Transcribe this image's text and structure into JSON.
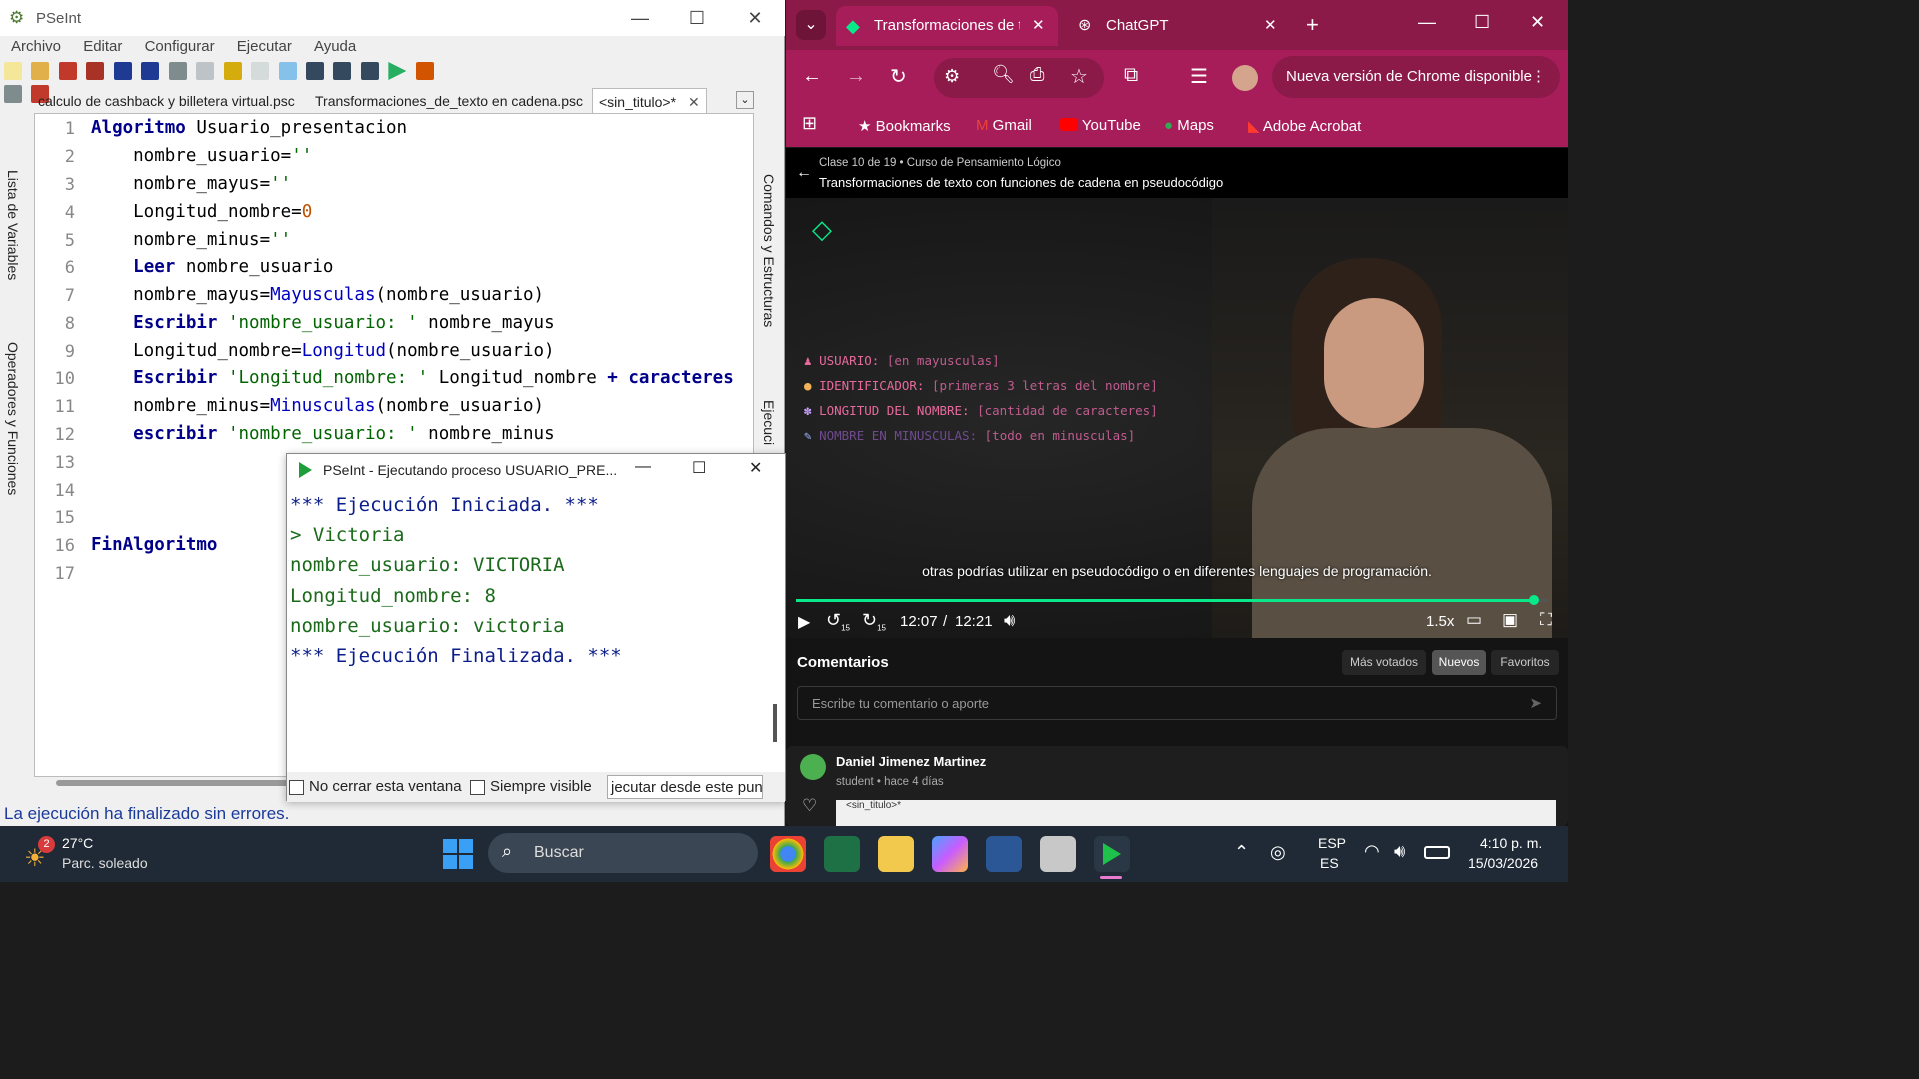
{
  "pseint": {
    "title": "PSeInt",
    "menu": [
      "Archivo",
      "Editar",
      "Configurar",
      "Ejecutar",
      "Ayuda"
    ],
    "tabs": [
      "calculo de cashback y billetera virtual.psc",
      "Transformaciones_de_texto en cadena.psc",
      "<sin_titulo>*"
    ],
    "left_panel": [
      "Lista de Variables",
      "Operadores y Funciones"
    ],
    "right_panel": [
      "Comandos y Estructuras",
      "Ejecuci"
    ],
    "status": "La ejecución ha finalizado sin errores.",
    "line_numbers": [
      "1",
      "2",
      "3",
      "4",
      "5",
      "6",
      "7",
      "8",
      "9",
      "10",
      "11",
      "12",
      "13",
      "14",
      "15",
      "16",
      "17"
    ],
    "code": {
      "l1_kw": "Algoritmo",
      "l1_rest": " Usuario_presentacion",
      "l2": "    nombre_usuario=",
      "l2_str": "''",
      "l3": "    nombre_mayus=",
      "l3_str": "''",
      "l4": "    Longitud_nombre=",
      "l4_num": "0",
      "l5": "    nombre_minus=",
      "l5_str": "''",
      "l6_kw": "Leer",
      "l6_rest": " nombre_usuario",
      "l7_a": "    nombre_mayus=",
      "l7_fn": "Mayusculas",
      "l7_b": "(nombre_usuario)",
      "l8_kw": "Escribir",
      "l8_str": " 'nombre_usuario: '",
      "l8_rest": " nombre_mayus",
      "l9_a": "    Longitud_nombre=",
      "l9_fn": "Longitud",
      "l9_b": "(nombre_usuario)",
      "l10_kw": "Escribir",
      "l10_str": " 'Longitud_nombre: '",
      "l10_rest": " Longitud_nombre ",
      "l10_op": "+",
      "l10_kw2": " caracteres",
      "l11_a": "    nombre_minus=",
      "l11_fn": "Minusculas",
      "l11_b": "(nombre_usuario)",
      "l12_kw": "escribir",
      "l12_str": " 'nombre_usuario: '",
      "l12_rest": " nombre_minus",
      "l16_kw": "FinAlgoritmo"
    }
  },
  "exec_window": {
    "title": "PSeInt - Ejecutando proceso USUARIO_PRE...",
    "output": [
      "*** Ejecución Iniciada. ***",
      "> Victoria",
      "nombre_usuario: VICTORIA",
      "Longitud_nombre: 8",
      "nombre_usuario: victoria",
      "*** Ejecución Finalizada. ***"
    ],
    "no_cerrar": "No cerrar esta ventana",
    "siempre_visible": "Siempre visible",
    "ejecutar_desde": "jecutar desde este punt"
  },
  "chrome": {
    "tabs": [
      {
        "label": "Transformaciones de t"
      },
      {
        "label": "ChatGPT"
      }
    ],
    "update_button": "Nueva versión de Chrome disponible",
    "bookmarks": [
      "Bookmarks",
      "Gmail",
      "YouTube",
      "Maps",
      "Adobe Acrobat"
    ],
    "video": {
      "class_info": "Clase 10 de 19 • Curso de Pensamiento Lógico",
      "title": "Transformaciones de texto con funciones de cadena en pseudocódigo",
      "slide_lines": [
        {
          "label": "USUARIO:",
          "value": "[en mayusculas]"
        },
        {
          "label": "IDENTIFICADOR:",
          "value": "[primeras 3 letras del nombre]"
        },
        {
          "label": "LONGITUD DEL NOMBRE:",
          "value": "[cantidad de caracteres]"
        },
        {
          "label": "NOMBRE EN MINUSCULAS:",
          "value": "[todo en minusculas]"
        }
      ],
      "subtitle": "otras podrías utilizar en pseudocódigo o en diferentes lenguajes de programación.",
      "current_time": "12:07",
      "separator": "/",
      "duration": "12:21",
      "progress": 0.981,
      "speed": "1.5x",
      "skip_back": "15",
      "skip_fwd": "15"
    },
    "comments": {
      "heading": "Comentarios",
      "filters": [
        "Más votados",
        "Nuevos",
        "Favoritos"
      ],
      "placeholder": "Escribe tu comentario o aporte",
      "author": "Daniel Jimenez Martinez",
      "role_time": "student • hace 4 días",
      "snippet_tab": "<sin_titulo>*"
    }
  },
  "taskbar": {
    "weather_temp": "27°C",
    "weather_desc": "Parc. soleado",
    "weather_badge": "2",
    "search": "Buscar",
    "lang1": "ESP",
    "lang2": "ES",
    "time": "4:10 p. m.",
    "date": "15/03/2026"
  },
  "colors": {
    "chrome_accent": "#a61d5a",
    "platzi_green": "#0ae98a",
    "keyword_blue": "#00008b",
    "output_green": "#1a6a1a"
  }
}
